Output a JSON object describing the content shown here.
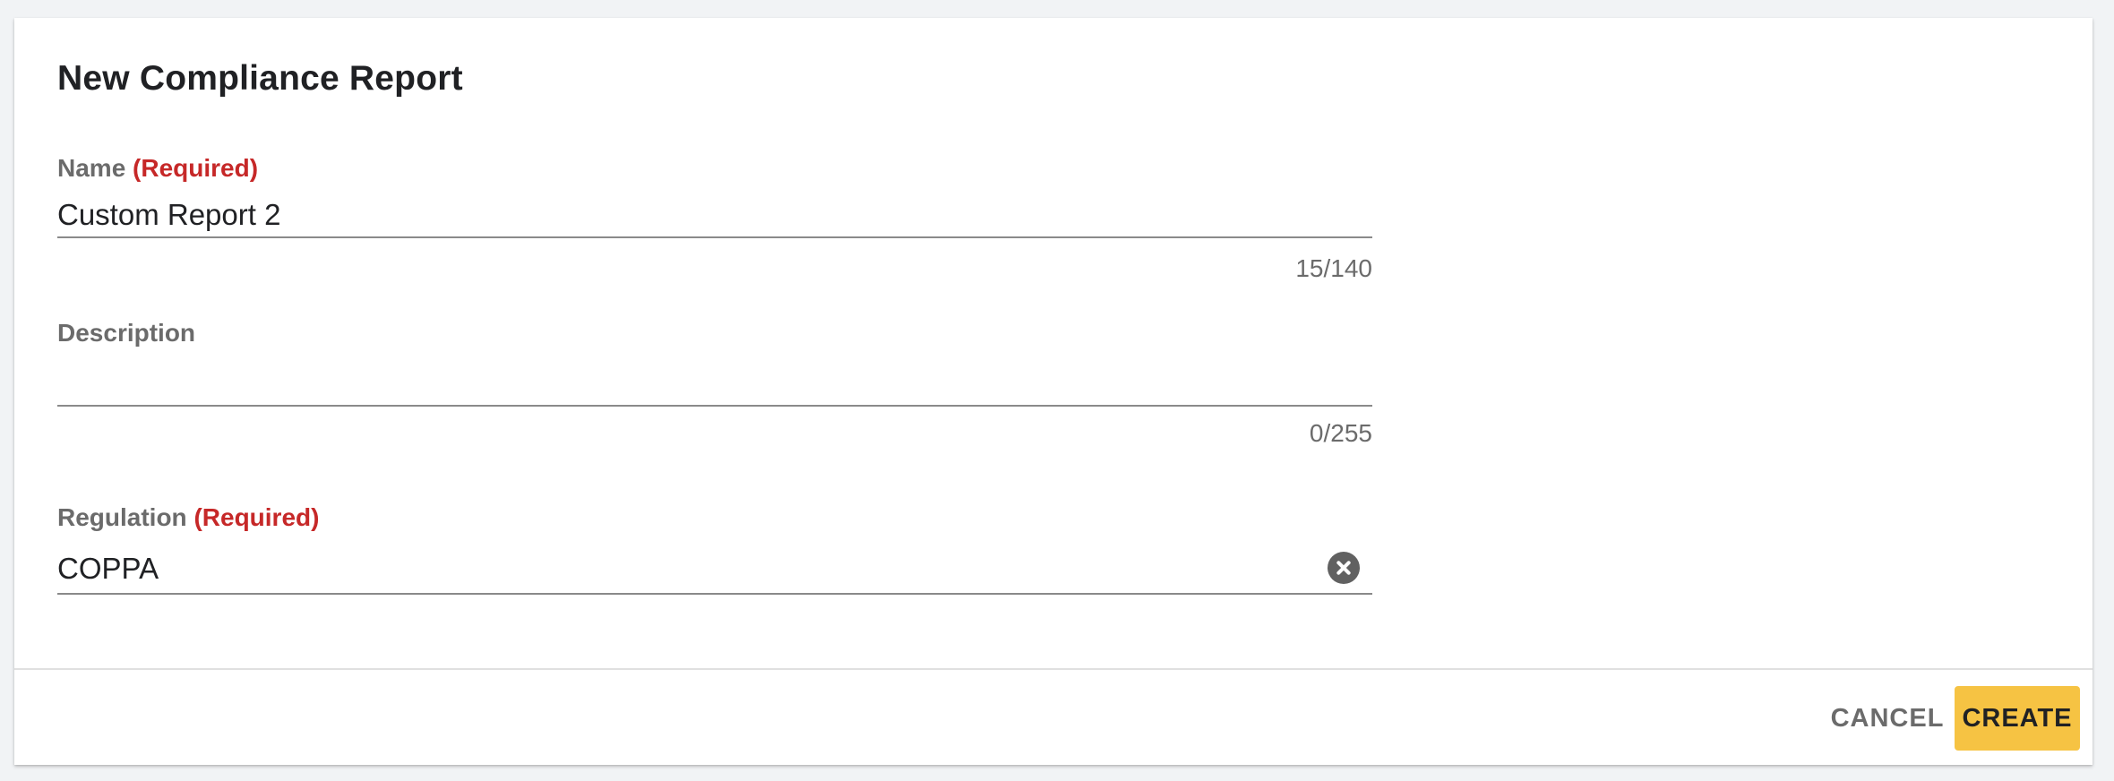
{
  "dialog": {
    "title": "New Compliance Report"
  },
  "fields": {
    "name": {
      "label": "Name",
      "required_tag": "(Required)",
      "value": "Custom Report 2",
      "counter": "15/140"
    },
    "description": {
      "label": "Description",
      "value": "",
      "counter": "0/255"
    },
    "regulation": {
      "label": "Regulation",
      "required_tag": "(Required)",
      "value": "COPPA",
      "clear_icon": "close-circle-icon"
    }
  },
  "actions": {
    "cancel_label": "CANCEL",
    "create_label": "CREATE"
  },
  "colors": {
    "required": "#c62828",
    "primary_button": "#f6c343",
    "label": "#6b6b6b",
    "text": "#202124"
  }
}
